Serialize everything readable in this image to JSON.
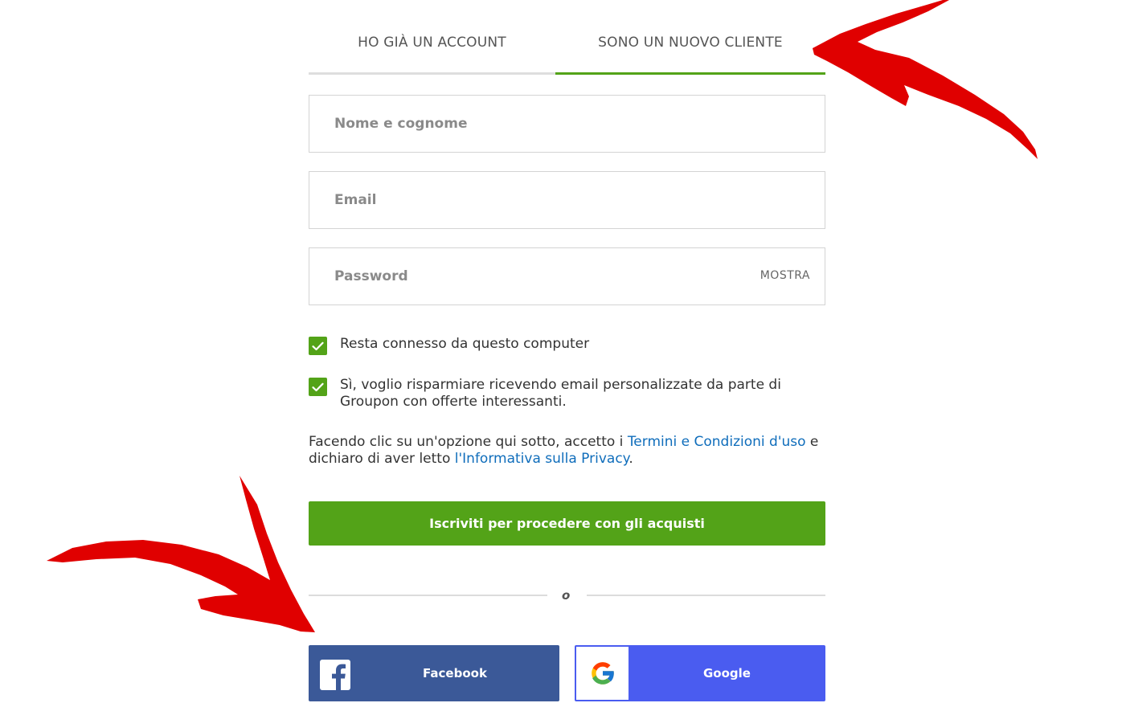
{
  "tabs": {
    "login_label": "HO GIÀ UN ACCOUNT",
    "signup_label": "SONO UN NUOVO CLIENTE",
    "active": "signup"
  },
  "fields": {
    "name_placeholder": "Nome e cognome",
    "email_placeholder": "Email",
    "password_placeholder": "Password",
    "show_password_label": "MOSTRA"
  },
  "checkboxes": [
    {
      "label": "Resta connesso da questo computer",
      "checked": true
    },
    {
      "label": "Sì, voglio risparmiare ricevendo email personalizzate da parte di Groupon con offerte interessanti.",
      "checked": true
    }
  ],
  "terms": {
    "prefix": "Facendo clic su un'opzione qui sotto, accetto i ",
    "terms_link": "Termini e Condizioni d'uso",
    "middle": " e dichiaro di aver letto ",
    "privacy_link": "l'Informativa sulla Privacy",
    "suffix": "."
  },
  "submit_label": "Iscriviti per procedere con gli acquisti",
  "divider_label": "o",
  "social": {
    "facebook_label": "Facebook",
    "google_label": "Google"
  },
  "colors": {
    "accent_green": "#53a318",
    "link_blue": "#0f6dbb",
    "facebook_blue": "#3b5998",
    "google_blue": "#4a5cf0",
    "annotation_red": "#e00000"
  },
  "icons": [
    "check-icon",
    "facebook-icon",
    "google-icon",
    "red-arrow-annotation"
  ]
}
